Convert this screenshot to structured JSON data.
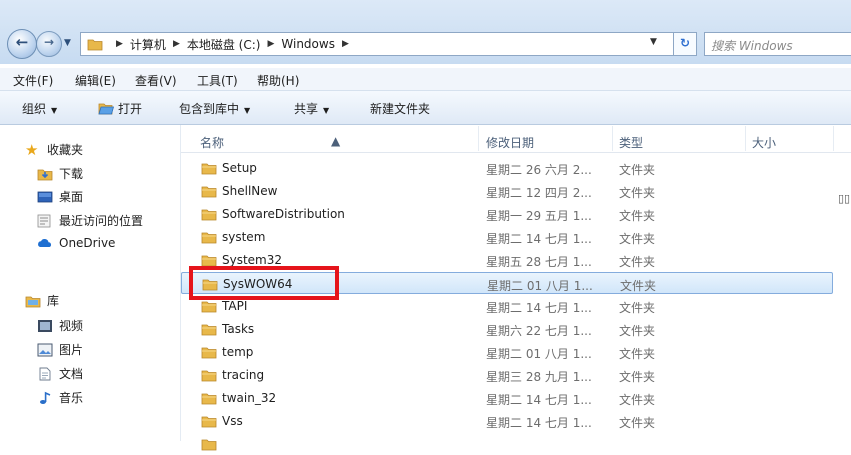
{
  "address": {
    "crumbs": [
      "计算机",
      "本地磁盘 (C:)",
      "Windows"
    ],
    "search_placeholder": "搜索 Windows"
  },
  "menu": [
    "文件(F)",
    "编辑(E)",
    "查看(V)",
    "工具(T)",
    "帮助(H)"
  ],
  "toolbar": {
    "organize": "组织",
    "open": "打开",
    "include_library": "包含到库中",
    "share": "共享",
    "new_folder": "新建文件夹"
  },
  "sidebar": {
    "favorites": "收藏夹",
    "downloads": "下载",
    "desktop": "桌面",
    "recent": "最近访问的位置",
    "onedrive": "OneDrive",
    "libraries": "库",
    "videos": "视频",
    "pictures": "图片",
    "documents": "文档",
    "music": "音乐"
  },
  "columns": {
    "name": "名称",
    "date": "修改日期",
    "type": "类型",
    "size": "大小"
  },
  "files": [
    {
      "name": "Setup",
      "date": "星期二 26 六月 2...",
      "type": "文件夹"
    },
    {
      "name": "ShellNew",
      "date": "星期二 12 四月 2...",
      "type": "文件夹"
    },
    {
      "name": "SoftwareDistribution",
      "date": "星期一 29 五月 1...",
      "type": "文件夹"
    },
    {
      "name": "system",
      "date": "星期二 14 七月 1...",
      "type": "文件夹"
    },
    {
      "name": "System32",
      "date": "星期五 28 七月 1...",
      "type": "文件夹"
    },
    {
      "name": "SysWOW64",
      "date": "星期二 01 八月 1...",
      "type": "文件夹"
    },
    {
      "name": "TAPI",
      "date": "星期二 14 七月 1...",
      "type": "文件夹"
    },
    {
      "name": "Tasks",
      "date": "星期六 22 七月 1...",
      "type": "文件夹"
    },
    {
      "name": "temp",
      "date": "星期二 01 八月 1...",
      "type": "文件夹"
    },
    {
      "name": "tracing",
      "date": "星期三 28 九月 1...",
      "type": "文件夹"
    },
    {
      "name": "twain_32",
      "date": "星期二 14 七月 1...",
      "type": "文件夹"
    },
    {
      "name": "Vss",
      "date": "星期二 14 七月 1...",
      "type": "文件夹"
    }
  ],
  "selected_file": "SysWOW64",
  "colors": {
    "selection_border": "#84acdd",
    "highlight": "#e5141b",
    "folder": "#e8b84a"
  }
}
